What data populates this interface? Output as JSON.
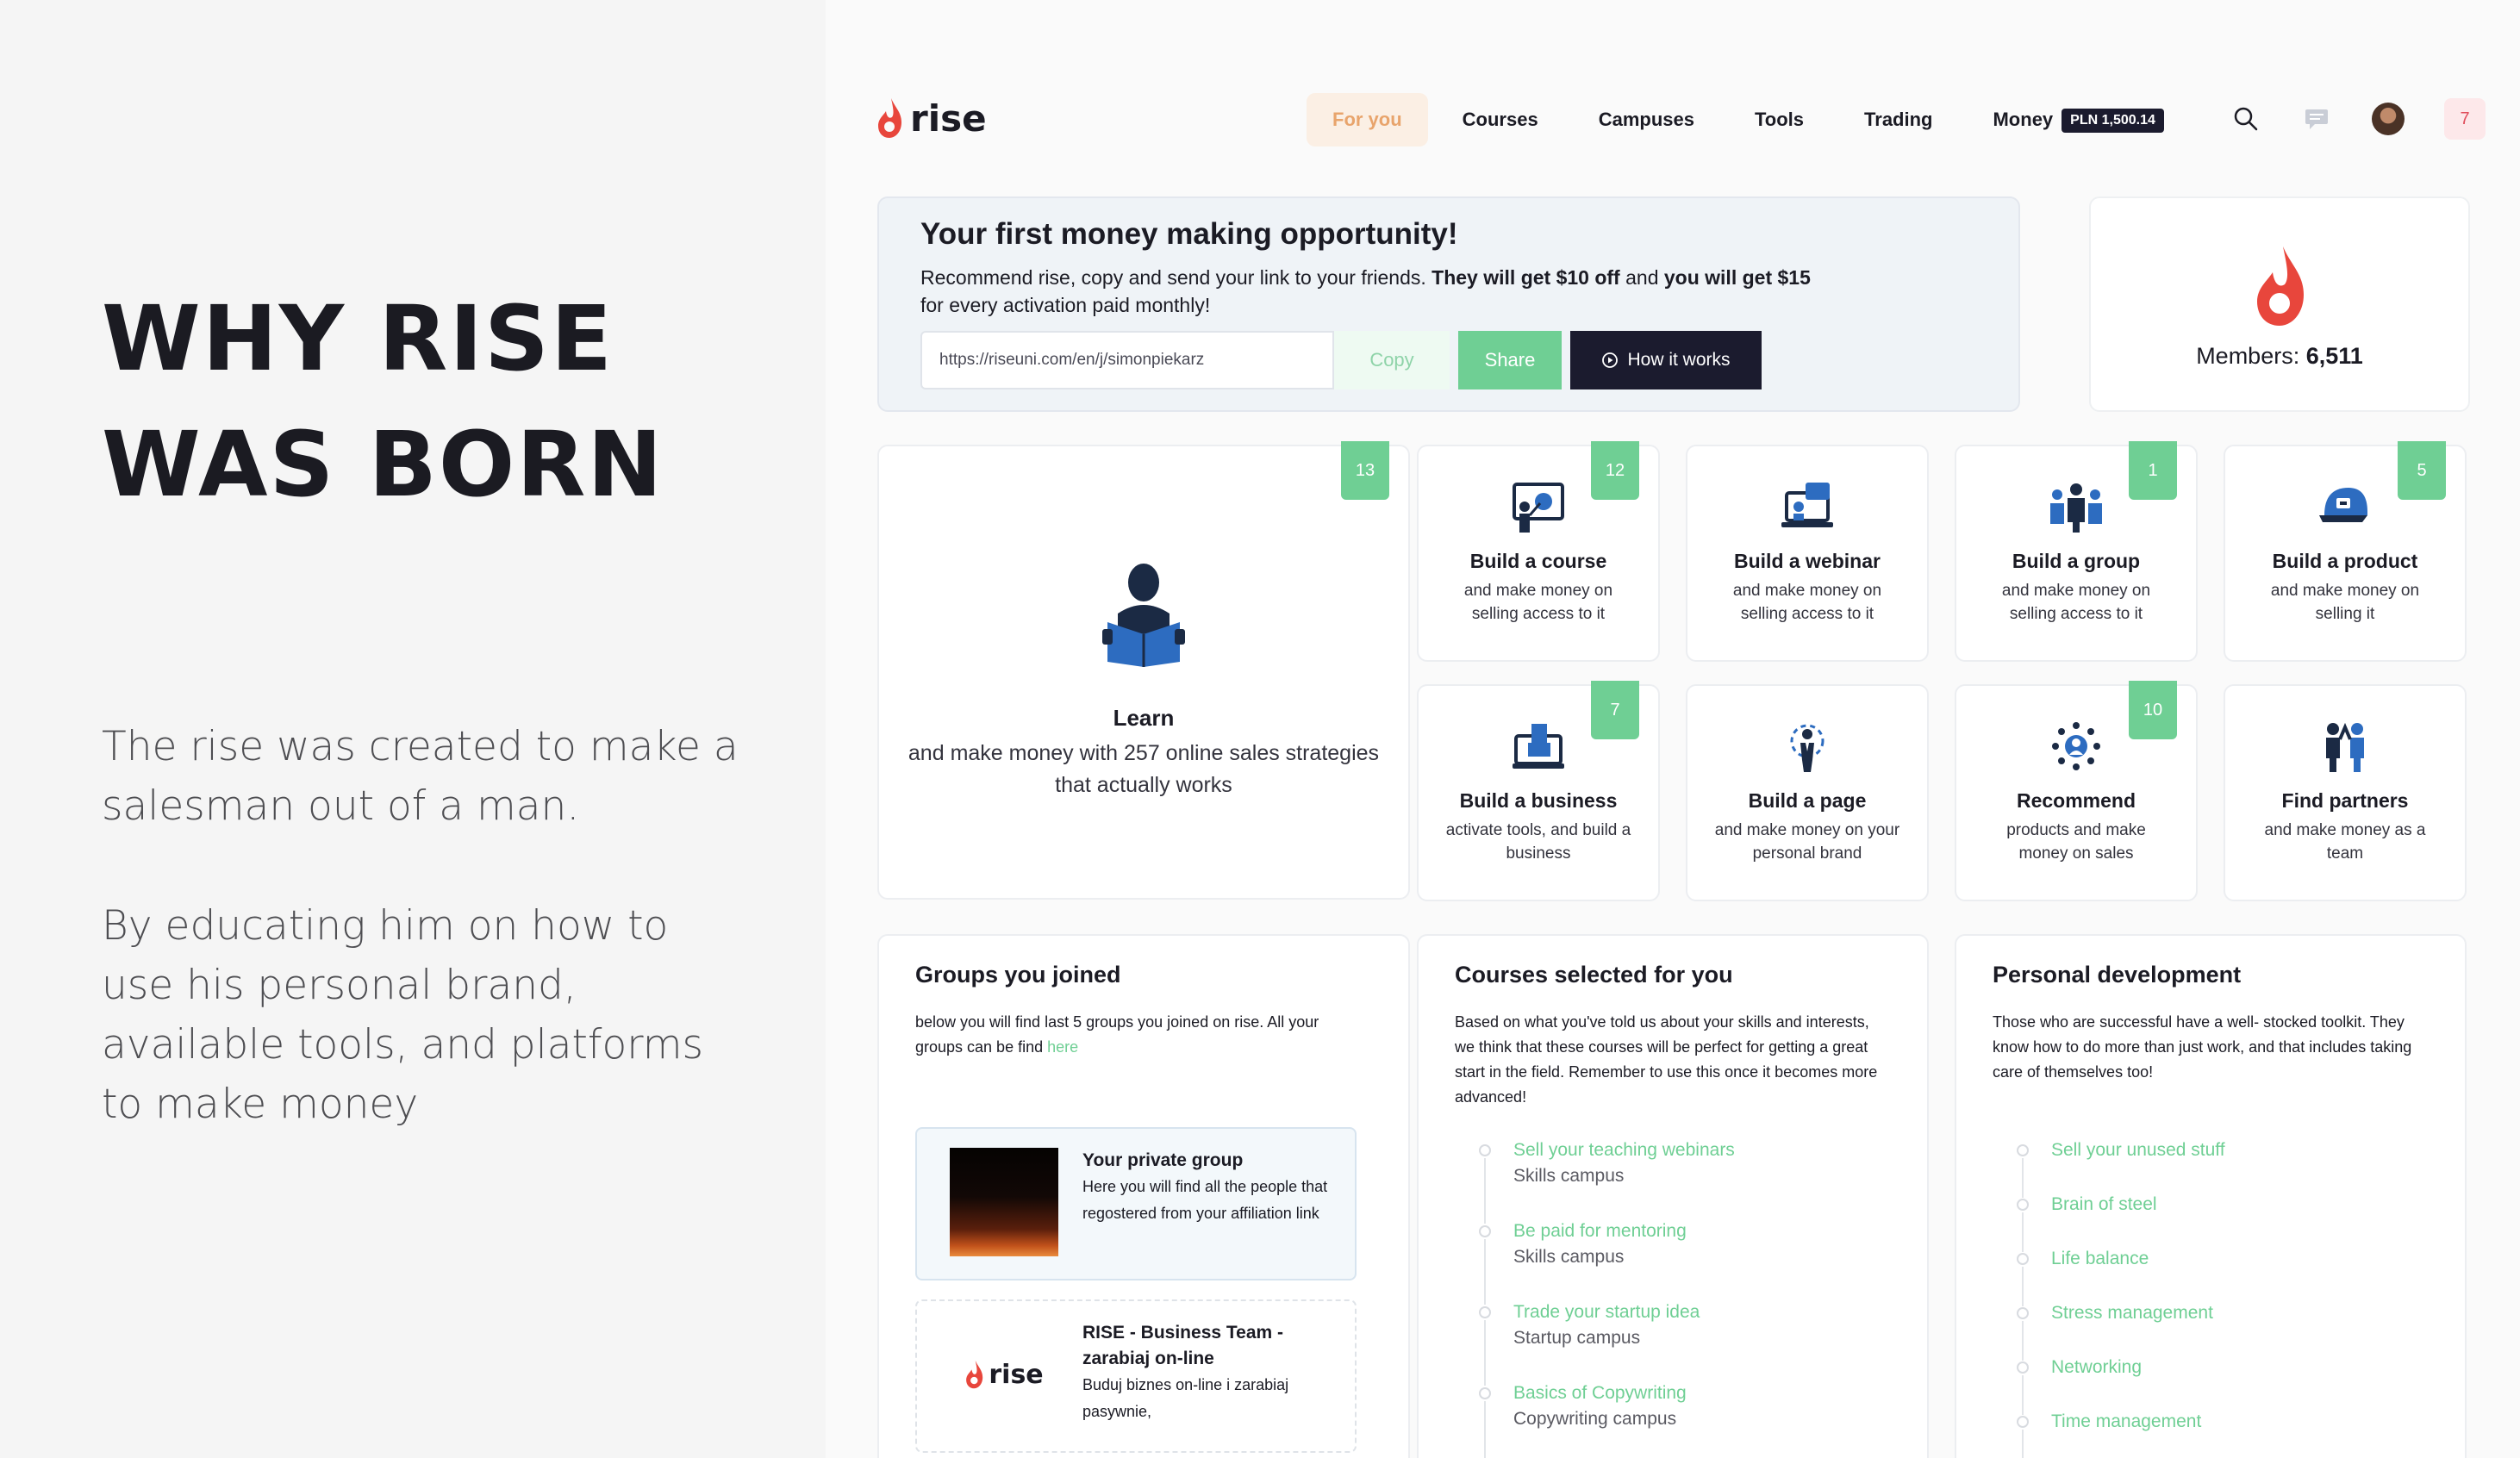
{
  "hero": {
    "title_line1": "WHY RISE",
    "title_line2": "WAS BORN",
    "para1": "The rise was created to make a salesman out of a man.",
    "para2": "By educating him on how to use his personal brand, available tools, and platforms to make money"
  },
  "nav": {
    "logo_text": "rise",
    "items": [
      "For you",
      "Courses",
      "Campuses",
      "Tools",
      "Trading",
      "Money"
    ],
    "money_balance": "PLN 1,500.14",
    "notifications": "7"
  },
  "opportunity": {
    "title": "Your first money making opportunity!",
    "desc_part1": "Recommend rise, copy and send your link to your friends. ",
    "desc_bold1": "They will get $10 off",
    "desc_part2": " and ",
    "desc_bold2": "you will get $15",
    "desc_part3": " for every activation paid monthly!",
    "link_value": "https://riseuni.com/en/j/simonpiekarz",
    "copy_label": "Copy",
    "share_label": "Share",
    "how_label": "How it works"
  },
  "members": {
    "label": "Members: ",
    "count": "6,511"
  },
  "tiles": {
    "learn": {
      "count": "13",
      "title": "Learn",
      "desc": "and make money with 257 online sales strategies that actually works"
    },
    "course": {
      "count": "12",
      "title": "Build a course",
      "desc": "and make money on selling access to it"
    },
    "webinar": {
      "title": "Build a webinar",
      "desc": "and make money on selling access to it"
    },
    "group": {
      "count": "1",
      "title": "Build a group",
      "desc": "and make money on selling access to it"
    },
    "product": {
      "count": "5",
      "title": "Build a product",
      "desc": "and make money on selling it"
    },
    "business": {
      "count": "7",
      "title": "Build a business",
      "desc": "activate tools, and build a business"
    },
    "page": {
      "title": "Build a page",
      "desc": "and make money on your personal brand"
    },
    "recommend": {
      "count": "10",
      "title": "Recommend",
      "desc": "products and make money on sales"
    },
    "partners": {
      "title": "Find partners",
      "desc": "and make money as a team"
    }
  },
  "groups": {
    "title": "Groups you joined",
    "desc": "below you will find last 5 groups you joined on rise. All your groups can be find ",
    "link": "here",
    "cards": [
      {
        "title": "Your private group",
        "desc": "Here you will find all the people that regostered from your affiliation link"
      },
      {
        "title": "RISE - Business Team - zarabiaj on-line",
        "desc": "Buduj biznes on-line i zarabiaj pasywnie,",
        "logo_text": "rise"
      }
    ]
  },
  "courses": {
    "title": "Courses selected for you",
    "desc": "Based on what you've told us about your skills and interests, we think that these courses will be perfect for getting a great start in the field. Remember to use this once it becomes more advanced!",
    "items": [
      {
        "title": "Sell your teaching webinars",
        "sub": "Skills campus"
      },
      {
        "title": "Be paid for mentoring",
        "sub": "Skills campus"
      },
      {
        "title": "Trade your startup idea",
        "sub": "Startup campus"
      },
      {
        "title": "Basics of Copywriting",
        "sub": "Copywriting campus"
      }
    ]
  },
  "personal": {
    "title": "Personal development",
    "desc": "Those who are successful have a well- stocked toolkit. They know how to do more than just work, and that includes taking care of themselves too!",
    "items": [
      "Sell your unused stuff",
      "Brain of steel",
      "Life balance",
      "Stress management",
      "Networking",
      "Time management"
    ]
  },
  "colors": {
    "accent_green": "#6fcf94",
    "dark": "#1b1b2e",
    "brand_red": "#e8463c",
    "icon_blue": "#2d6cc0"
  }
}
